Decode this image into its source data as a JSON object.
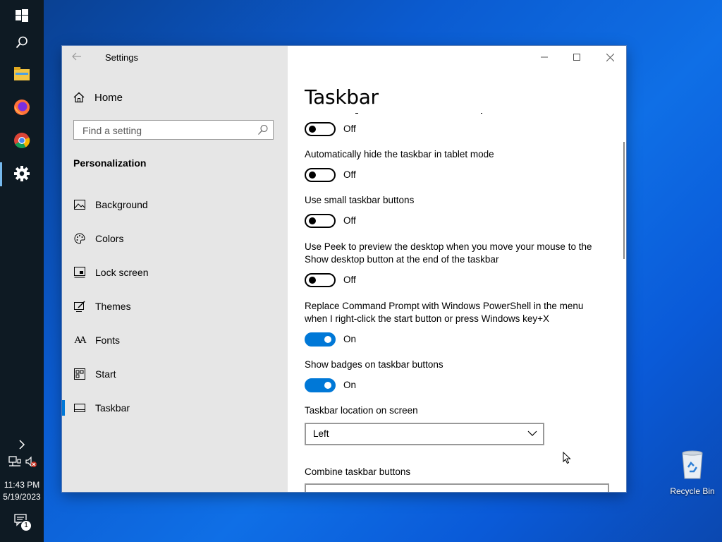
{
  "taskbar": {
    "time": "11:43 PM",
    "date": "5/19/2023",
    "notification_count": "1",
    "icons": [
      "windows-start-icon",
      "search-icon",
      "file-explorer-icon",
      "firefox-icon",
      "chrome-icon",
      "settings-gear-icon"
    ]
  },
  "desktop": {
    "recycle_bin_label": "Recycle Bin"
  },
  "window": {
    "app_title": "Settings",
    "home_label": "Home",
    "search_placeholder": "Find a setting",
    "section_heading": "Personalization",
    "nav_items": [
      {
        "label": "Background",
        "icon": "image-icon"
      },
      {
        "label": "Colors",
        "icon": "palette-icon"
      },
      {
        "label": "Lock screen",
        "icon": "lock-screen-icon"
      },
      {
        "label": "Themes",
        "icon": "brush-icon"
      },
      {
        "label": "Fonts",
        "icon": "font-icon"
      },
      {
        "label": "Start",
        "icon": "start-tiles-icon"
      },
      {
        "label": "Taskbar",
        "icon": "taskbar-icon",
        "selected": true
      }
    ],
    "page_title": "Taskbar",
    "settings": [
      {
        "label": "",
        "state": "Off",
        "on": false
      },
      {
        "label": "Automatically hide the taskbar in tablet mode",
        "state": "Off",
        "on": false
      },
      {
        "label": "Use small taskbar buttons",
        "state": "Off",
        "on": false
      },
      {
        "label": "Use Peek to preview the desktop when you move your mouse to the Show desktop button at the end of the taskbar",
        "state": "Off",
        "on": false
      },
      {
        "label": "Replace Command Prompt with Windows PowerShell in the menu when I right-click the start button or press Windows key+X",
        "state": "On",
        "on": true
      },
      {
        "label": "Show badges on taskbar buttons",
        "state": "On",
        "on": true
      }
    ],
    "location_label": "Taskbar location on screen",
    "location_value": "Left",
    "combine_label": "Combine taskbar buttons"
  },
  "colors": {
    "accent": "#0078d7",
    "nav_bg": "#e6e6e6",
    "taskbar_bg": "#0e1a23"
  }
}
